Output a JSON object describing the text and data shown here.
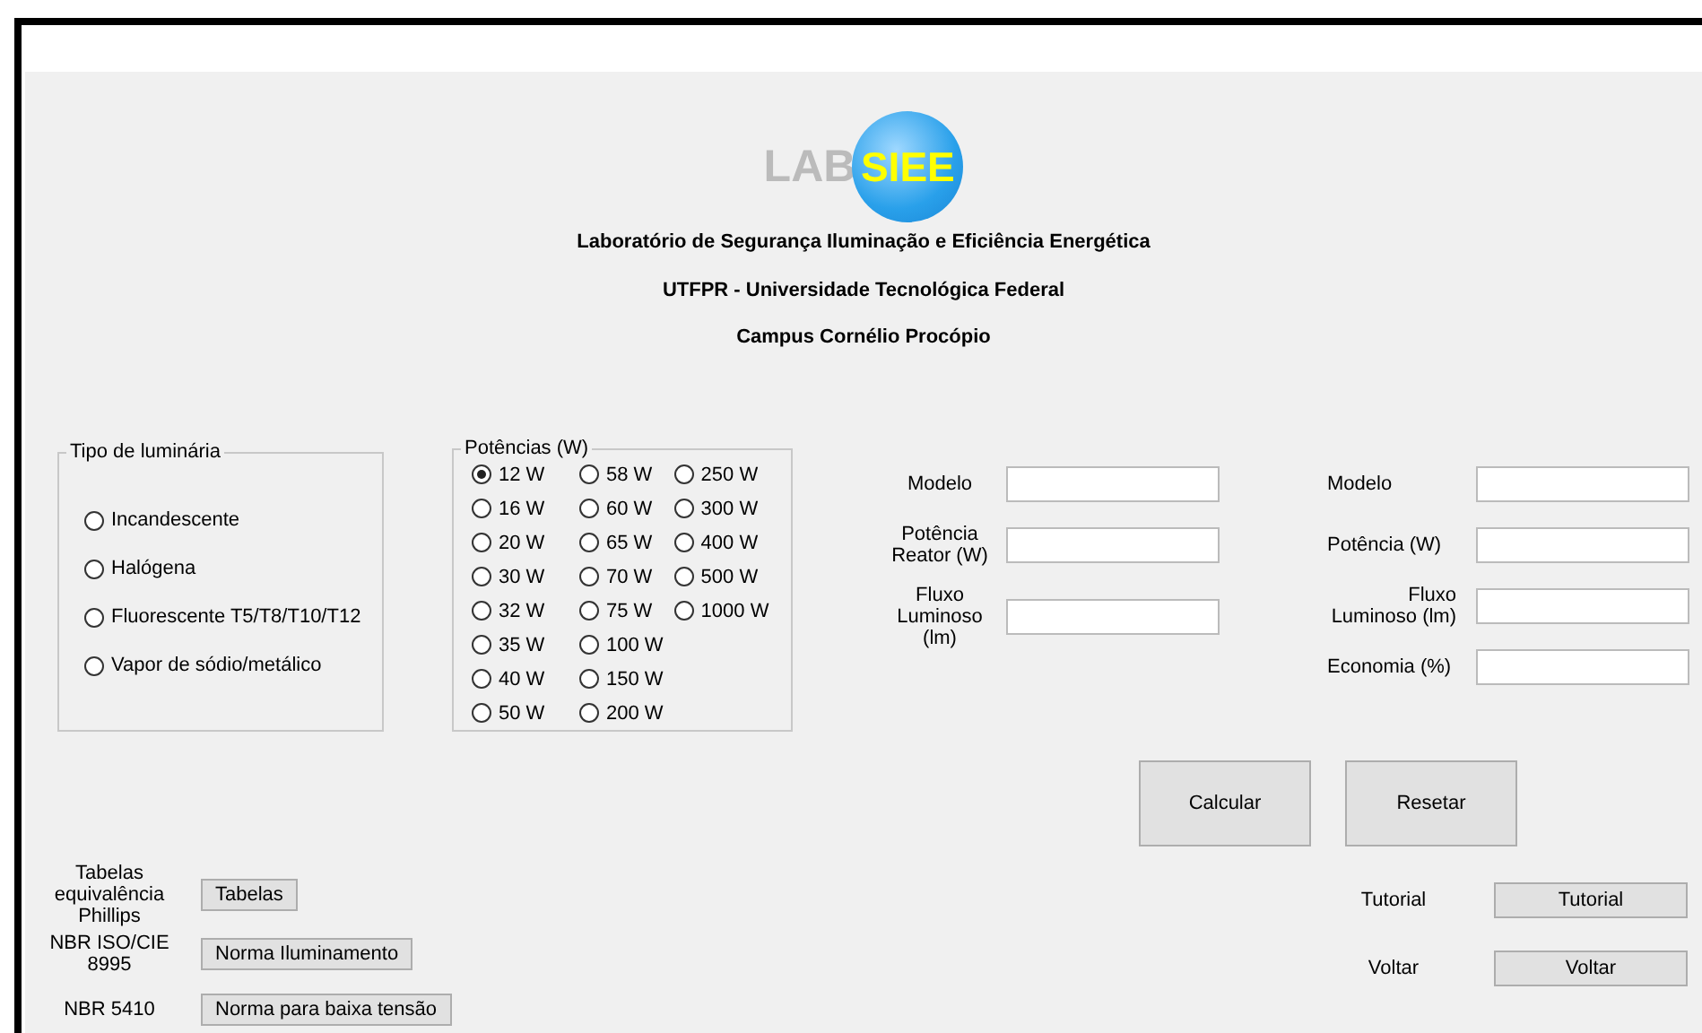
{
  "logo": {
    "text": "LAB",
    "emblem": "SIEE"
  },
  "titles": [
    "Laboratório de Segurança Iluminação e Eficiência Energética",
    "UTFPR - Universidade Tecnológica Federal",
    "Campus Cornélio Procópio"
  ],
  "luminaire_type": {
    "title": "Tipo de luminária",
    "options": [
      {
        "label": "Incandescente",
        "selected": false
      },
      {
        "label": "Halógena",
        "selected": false
      },
      {
        "label": "Fluorescente T5/T8/T10/T12",
        "selected": false
      },
      {
        "label": "Vapor de sódio/metálico",
        "selected": false
      }
    ]
  },
  "powers": {
    "title": "Potências (W)",
    "columns": [
      [
        {
          "label": "12 W",
          "selected": true
        },
        {
          "label": "16 W",
          "selected": false
        },
        {
          "label": "20 W",
          "selected": false
        },
        {
          "label": "30 W",
          "selected": false
        },
        {
          "label": "32 W",
          "selected": false
        },
        {
          "label": "35 W",
          "selected": false
        },
        {
          "label": "40 W",
          "selected": false
        },
        {
          "label": "50 W",
          "selected": false
        }
      ],
      [
        {
          "label": "58 W",
          "selected": false
        },
        {
          "label": "60 W",
          "selected": false
        },
        {
          "label": "65 W",
          "selected": false
        },
        {
          "label": "70 W",
          "selected": false
        },
        {
          "label": "75 W",
          "selected": false
        },
        {
          "label": "100 W",
          "selected": false
        },
        {
          "label": "150 W",
          "selected": false
        },
        {
          "label": "200 W",
          "selected": false
        }
      ],
      [
        {
          "label": "250 W",
          "selected": false
        },
        {
          "label": "300 W",
          "selected": false
        },
        {
          "label": "400 W",
          "selected": false
        },
        {
          "label": "500 W",
          "selected": false
        },
        {
          "label": "1000 W",
          "selected": false
        }
      ]
    ]
  },
  "left_fields": [
    {
      "label": "Modelo"
    },
    {
      "label": "Potência Reator (W)"
    },
    {
      "label": "Fluxo Luminoso (lm)"
    }
  ],
  "right_fields": [
    {
      "label": "Modelo"
    },
    {
      "label": "Potência (W)"
    },
    {
      "label": "Fluxo Luminoso (lm)"
    },
    {
      "label": "Economia (%)"
    }
  ],
  "actions": [
    "Calcular",
    "Resetar"
  ],
  "references": [
    {
      "label": "Tabelas equivalência Phillips",
      "button": "Tabelas"
    },
    {
      "label": "NBR ISO/CIE 8995",
      "button": "Norma Iluminamento"
    },
    {
      "label": "NBR 5410",
      "button": "Norma para baixa tensão"
    }
  ],
  "navigation": [
    {
      "label": "Tutorial",
      "button": "Tutorial"
    },
    {
      "label": "Voltar",
      "button": "Voltar"
    }
  ]
}
